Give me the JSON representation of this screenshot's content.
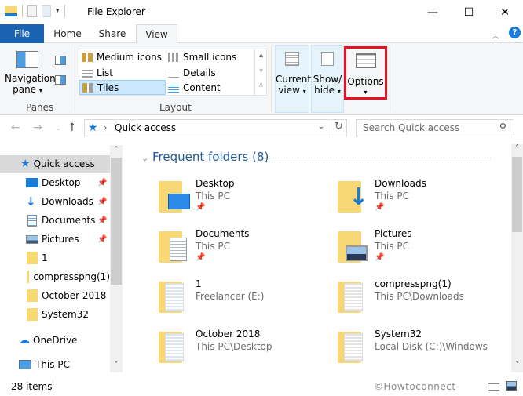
{
  "window": {
    "title": "File Explorer",
    "controls": {
      "minimize": "—",
      "maximize": "☐",
      "close": "✕"
    }
  },
  "tabs": [
    {
      "label": "File"
    },
    {
      "label": "Home"
    },
    {
      "label": "Share"
    },
    {
      "label": "View",
      "active": true
    }
  ],
  "ribbon": {
    "panes": {
      "navigation_pane_label_line1": "Navigation",
      "navigation_pane_label_line2": "pane",
      "group_label": "Panes"
    },
    "layout": {
      "items": [
        {
          "label": "Medium icons"
        },
        {
          "label": "Small icons"
        },
        {
          "label": "List"
        },
        {
          "label": "Details"
        },
        {
          "label": "Tiles",
          "selected": true
        },
        {
          "label": "Content"
        }
      ],
      "group_label": "Layout"
    },
    "current_view": {
      "line1": "Current",
      "line2": "view"
    },
    "show_hide": {
      "line1": "Show/",
      "line2": "hide"
    },
    "options": {
      "label": "Options",
      "highlight_color": "#e81123"
    }
  },
  "address": {
    "location": "Quick access",
    "search_placeholder": "Search Quick access"
  },
  "nav_pane": {
    "items": [
      {
        "label": "Quick access",
        "icon": "star-icon",
        "selected": true
      },
      {
        "label": "Desktop",
        "icon": "desktop-icon",
        "pinned": true
      },
      {
        "label": "Downloads",
        "icon": "download-icon",
        "pinned": true
      },
      {
        "label": "Documents",
        "icon": "documents-icon",
        "pinned": true
      },
      {
        "label": "Pictures",
        "icon": "pictures-icon",
        "pinned": true
      },
      {
        "label": "1",
        "icon": "folder-icon"
      },
      {
        "label": "compresspng(1)",
        "icon": "folder-icon"
      },
      {
        "label": "October 2018",
        "icon": "folder-icon"
      },
      {
        "label": "System32",
        "icon": "folder-icon"
      },
      {
        "label": "OneDrive",
        "icon": "onedrive-icon"
      },
      {
        "label": "This PC",
        "icon": "this-pc-icon"
      }
    ]
  },
  "content": {
    "group_header": "Frequent folders (8)",
    "tiles": [
      {
        "name": "Desktop",
        "location": "This PC",
        "pinned": true,
        "overlay": "desktop"
      },
      {
        "name": "Downloads",
        "location": "This PC",
        "pinned": true,
        "overlay": "download"
      },
      {
        "name": "Documents",
        "location": "This PC",
        "pinned": true,
        "overlay": "documents"
      },
      {
        "name": "Pictures",
        "location": "This PC",
        "pinned": true,
        "overlay": "pictures"
      },
      {
        "name": "1",
        "location": "Freelancer (E:)",
        "pinned": false,
        "overlay": "files"
      },
      {
        "name": "compresspng(1)",
        "location": "This PC\\Downloads",
        "pinned": false,
        "overlay": "files"
      },
      {
        "name": "October 2018",
        "location": "This PC\\Desktop",
        "pinned": false,
        "overlay": "files"
      },
      {
        "name": "System32",
        "location": "Local Disk (C:)\\Windows",
        "pinned": false,
        "overlay": "files"
      }
    ]
  },
  "status": {
    "item_count": "28 items",
    "watermark": "©Howtoconnect"
  },
  "colors": {
    "file_tab": "#1a63b3",
    "accent_text": "#1e5a9c",
    "folder": "#f8d775",
    "selection": "#cce8ff"
  }
}
